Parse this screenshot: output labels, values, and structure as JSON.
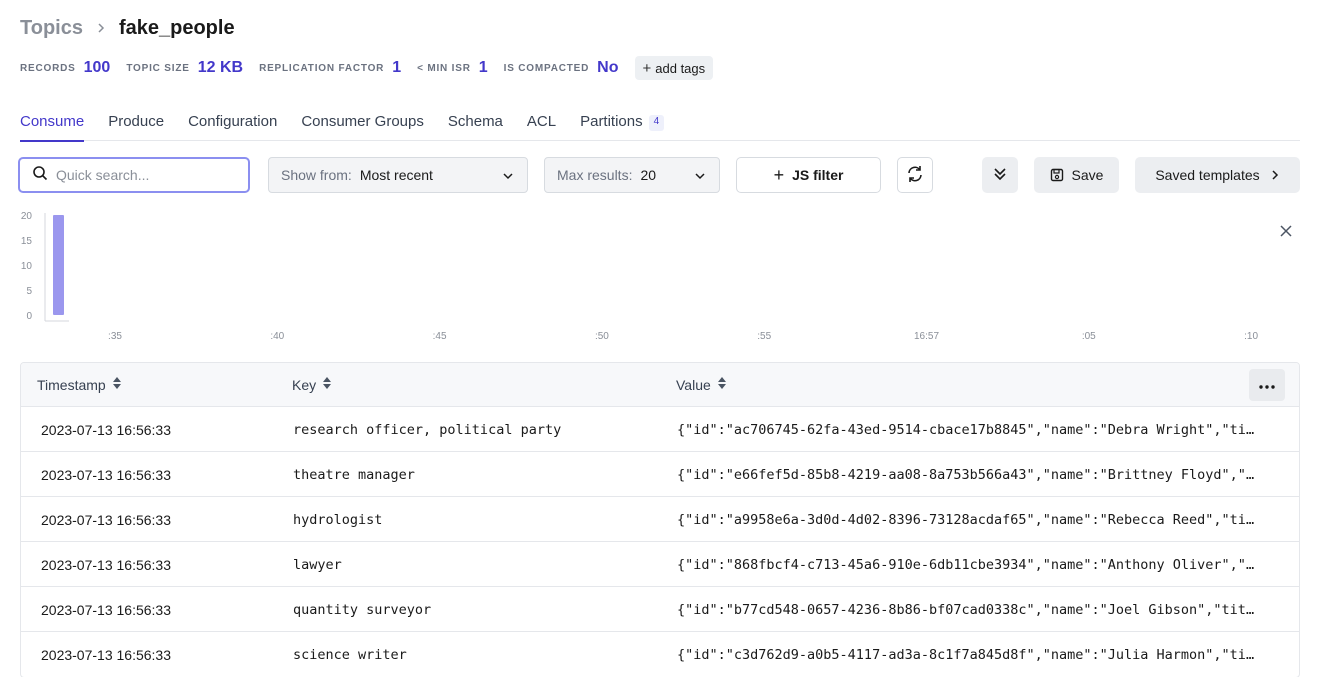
{
  "breadcrumb": {
    "root": "Topics",
    "current": "fake_people"
  },
  "stats": [
    {
      "label": "RECORDS",
      "value": "100"
    },
    {
      "label": "TOPIC SIZE",
      "value": "12 KB"
    },
    {
      "label": "REPLICATION FACTOR",
      "value": "1"
    },
    {
      "label": "< MIN ISR",
      "value": "1"
    },
    {
      "label": "IS COMPACTED",
      "value": "No"
    }
  ],
  "add_tags_label": "add tags",
  "tabs": [
    {
      "label": "Consume"
    },
    {
      "label": "Produce"
    },
    {
      "label": "Configuration"
    },
    {
      "label": "Consumer Groups"
    },
    {
      "label": "Schema"
    },
    {
      "label": "ACL"
    },
    {
      "label": "Partitions",
      "badge": "4"
    }
  ],
  "toolbar": {
    "search_placeholder": "Quick search...",
    "show_from_label": "Show from:",
    "show_from_value": "Most recent",
    "max_results_label": "Max results:",
    "max_results_value": "20",
    "js_filter_label": "JS filter",
    "save_label": "Save",
    "saved_templates_label": "Saved templates"
  },
  "colors": {
    "accent": "#4338ca",
    "bar": "#9b97ee",
    "focus": "#8b8ff0"
  },
  "chart_data": {
    "type": "bar",
    "x": [
      ":35",
      ":40",
      ":45",
      ":50",
      ":55",
      "16:57",
      ":05",
      ":10"
    ],
    "y_ticks": [
      0,
      5,
      10,
      15,
      20
    ],
    "ylim": [
      0,
      20
    ],
    "bars": [
      {
        "x_position": "first bucket",
        "value": 20
      }
    ],
    "grid": false,
    "legend": "none"
  },
  "table": {
    "columns": [
      "Timestamp",
      "Key",
      "Value"
    ],
    "rows": [
      {
        "timestamp": "2023-07-13 16:56:33",
        "key": "research officer, political party",
        "value": "{\"id\":\"ac706745-62fa-43ed-9514-cbace17b8845\",\"name\":\"Debra Wright\",\"ti…"
      },
      {
        "timestamp": "2023-07-13 16:56:33",
        "key": "theatre manager",
        "value": "{\"id\":\"e66fef5d-85b8-4219-aa08-8a753b566a43\",\"name\":\"Brittney Floyd\",\"…"
      },
      {
        "timestamp": "2023-07-13 16:56:33",
        "key": "hydrologist",
        "value": "{\"id\":\"a9958e6a-3d0d-4d02-8396-73128acdaf65\",\"name\":\"Rebecca Reed\",\"ti…"
      },
      {
        "timestamp": "2023-07-13 16:56:33",
        "key": "lawyer",
        "value": "{\"id\":\"868fbcf4-c713-45a6-910e-6db11cbe3934\",\"name\":\"Anthony Oliver\",\"…"
      },
      {
        "timestamp": "2023-07-13 16:56:33",
        "key": "quantity surveyor",
        "value": "{\"id\":\"b77cd548-0657-4236-8b86-bf07cad0338c\",\"name\":\"Joel Gibson\",\"tit…"
      },
      {
        "timestamp": "2023-07-13 16:56:33",
        "key": "science writer",
        "value": "{\"id\":\"c3d762d9-a0b5-4117-ad3a-8c1f7a845d8f\",\"name\":\"Julia Harmon\",\"ti…"
      }
    ]
  }
}
